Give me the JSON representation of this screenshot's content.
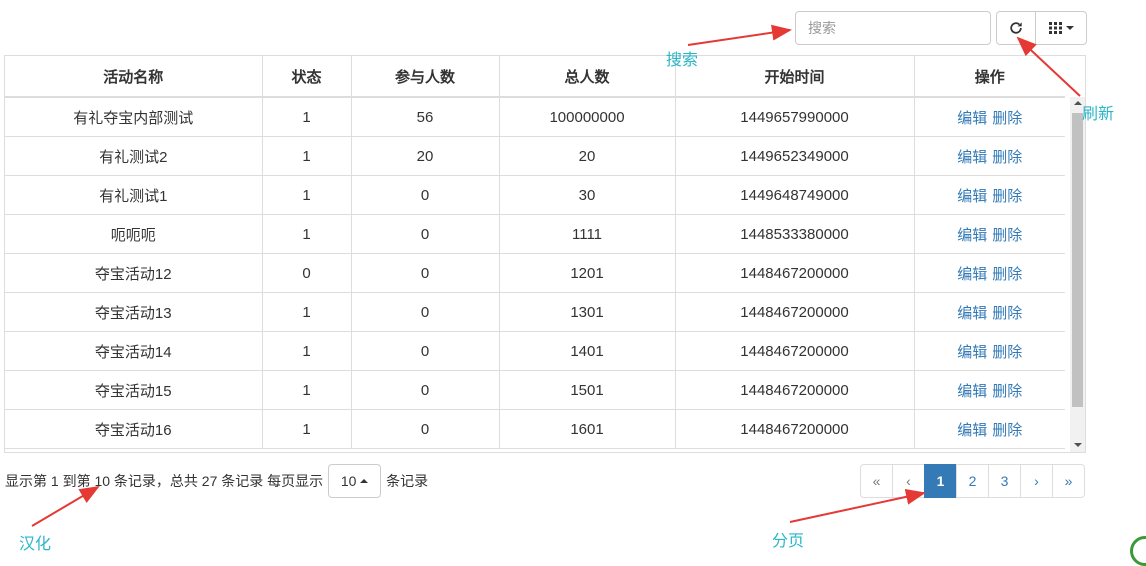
{
  "search": {
    "placeholder": "搜索"
  },
  "toolbar": {
    "refresh_icon": "refresh-icon",
    "columns_icon": "grid-columns-icon"
  },
  "table": {
    "headers": [
      "活动名称",
      "状态",
      "参与人数",
      "总人数",
      "开始时间",
      "操作"
    ],
    "rows": [
      [
        "有礼夺宝内部测试",
        "1",
        "56",
        "100000000",
        "1449657990000"
      ],
      [
        "有礼测试2",
        "1",
        "20",
        "20",
        "1449652349000"
      ],
      [
        "有礼测试1",
        "1",
        "0",
        "30",
        "1449648749000"
      ],
      [
        "呃呃呃",
        "1",
        "0",
        "1111",
        "1448533380000"
      ],
      [
        "夺宝活动12",
        "0",
        "0",
        "1201",
        "1448467200000"
      ],
      [
        "夺宝活动13",
        "1",
        "0",
        "1301",
        "1448467200000"
      ],
      [
        "夺宝活动14",
        "1",
        "0",
        "1401",
        "1448467200000"
      ],
      [
        "夺宝活动15",
        "1",
        "0",
        "1501",
        "1448467200000"
      ],
      [
        "夺宝活动16",
        "1",
        "0",
        "1601",
        "1448467200000"
      ]
    ],
    "actions": {
      "edit": "编辑",
      "delete": "删除"
    }
  },
  "footer": {
    "info_text": "显示第 1 到第 10 条记录，总共 27 条记录 每页显示",
    "page_size": "10",
    "records_suffix": "条记录"
  },
  "pagination": {
    "first": "«",
    "prev": "‹",
    "pages": [
      "1",
      "2",
      "3"
    ],
    "active_page": "1",
    "next": "›",
    "last": "»"
  },
  "annotations": {
    "search": "搜索",
    "refresh": "刷新",
    "localize": "汉化",
    "paging": "分页"
  },
  "colors": {
    "link": "#337ab7",
    "active_page": "#337ab7",
    "annotation_text": "#29b6c6",
    "annotation_arrow": "#e53935"
  }
}
